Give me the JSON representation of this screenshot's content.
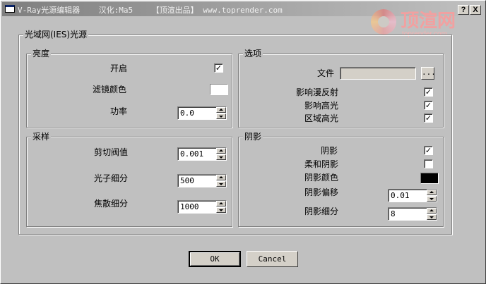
{
  "window": {
    "title": "V-Ray光源编辑器    汉化:Ma5    【顶渲出品】 www.toprender.com",
    "help_button": "?",
    "close_button": "X"
  },
  "watermark": {
    "text": "顶渲网",
    "url": "toprender.com"
  },
  "ies_group": {
    "title": "光域网(IES)光源"
  },
  "brightness": {
    "title": "亮度",
    "on_label": "开启",
    "on_checked": "✓",
    "filter_color_label": "滤镜颜色",
    "filter_color": "#ffffff",
    "power_label": "功率",
    "power_value": "0.0"
  },
  "options": {
    "title": "选项",
    "file_label": "文件",
    "file_value": "",
    "browse_label": "...",
    "diffuse_label": "影响漫反射",
    "diffuse_checked": "✓",
    "specular_label": "影响高光",
    "specular_checked": "✓",
    "area_specular_label": "区域高光",
    "area_specular_checked": "✓"
  },
  "sampling": {
    "title": "采样",
    "cutoff_label": "剪切阀值",
    "cutoff_value": "0.001",
    "photon_label": "光子细分",
    "photon_value": "500",
    "caustic_label": "焦散细分",
    "caustic_value": "1000"
  },
  "shadow": {
    "title": "阴影",
    "shadows_label": "阴影",
    "shadows_checked": "✓",
    "soft_label": "柔和阴影",
    "soft_checked": "",
    "color_label": "阴影颜色",
    "color": "#000000",
    "bias_label": "阴影偏移",
    "bias_value": "0.01",
    "subdivs_label": "阴影细分",
    "subdivs_value": "8"
  },
  "buttons": {
    "ok": "OK",
    "cancel": "Cancel"
  }
}
